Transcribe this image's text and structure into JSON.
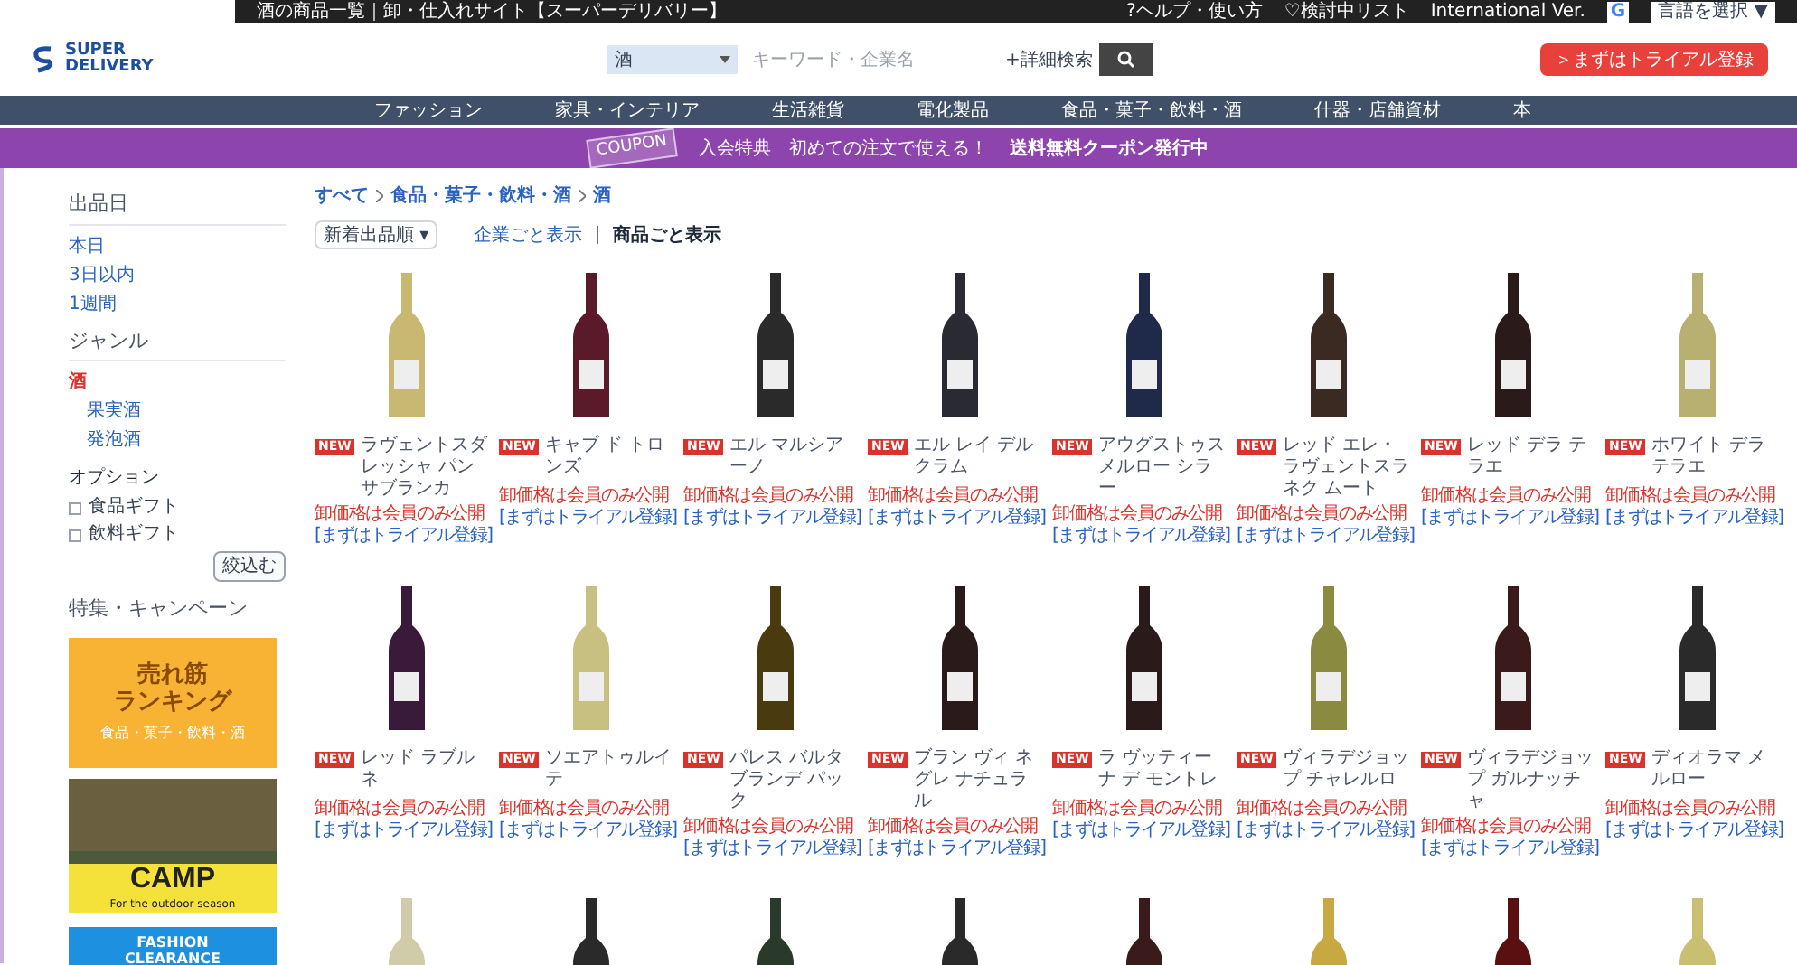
{
  "top_bar": {
    "page_title": "酒の商品一覧｜卸・仕入れサイト【スーパーデリバリー】",
    "links": [
      "?ヘルプ・使い方",
      "♡検討中リスト",
      "International Ver."
    ],
    "language_icon": "G",
    "language": "言語を選択 ▼"
  },
  "header": {
    "logo": [
      "SUPER",
      "DELIVERY"
    ],
    "search": {
      "category": "酒",
      "placeholder": "キーワード・企業名",
      "advanced": "+詳細検索"
    },
    "trial_button": "＞まずはトライアル登録"
  },
  "nav": [
    "ファッション",
    "家具・インテリア",
    "生活雑貨",
    "電化製品",
    "食品・菓子・飲料・酒",
    "什器・店舗資材",
    "本"
  ],
  "coupon_banner": {
    "badge": "COUPON",
    "text": "入会特典　初めての注文で使える！",
    "highlight": "送料無料クーポン発行中"
  },
  "sidebar": {
    "sections": [
      {
        "title": "出品日",
        "items": [
          {
            "label": "本日",
            "selected": false
          },
          {
            "label": "3日以内",
            "selected": false
          },
          {
            "label": "1週間",
            "selected": false
          }
        ]
      },
      {
        "title": "ジャンル",
        "items": [
          {
            "label": "酒",
            "selected": true,
            "children": [
              {
                "label": "果実酒",
                "selected": false
              },
              {
                "label": "発泡酒",
                "selected": false
              }
            ]
          }
        ]
      }
    ],
    "options": {
      "title": "オプション",
      "items": [
        {
          "label": "食品ギフト",
          "checked": false
        },
        {
          "label": "飲料ギフト",
          "checked": false
        }
      ]
    },
    "filter_button": "絞込む",
    "campaign_title": "特集・キャンペーン",
    "banners": [
      {
        "kind": "ranking",
        "lines": [
          "売れ筋",
          "ランキング"
        ],
        "sub": "食品・菓子・飲料・酒"
      },
      {
        "kind": "camp",
        "lines": [
          "CAMP"
        ],
        "sub": "For the outdoor season"
      },
      {
        "kind": "sale",
        "lines": [
          "FASHION",
          "CLEARANCE"
        ]
      }
    ]
  },
  "breadcrumb": [
    "すべて",
    "食品・菓子・飲料・酒",
    "酒"
  ],
  "sort": {
    "select": "新着出品順 ▾",
    "views": [
      {
        "label": "企業ごと表示",
        "selected": false
      },
      {
        "label": "商品ごと表示",
        "selected": true
      }
    ]
  },
  "products": [
    {
      "kind": "full",
      "badge": "NEW",
      "name": "ラヴェントスダレッシャ パンサブランカ",
      "price": "卸価格は会員のみ公開",
      "link": "[まずはトライアル登録]",
      "color": "#c9b872"
    },
    {
      "kind": "full",
      "badge": "NEW",
      "name": "キャブ ド トロンズ",
      "price": "卸価格は会員のみ公開",
      "link": "[まずはトライアル登録]",
      "color": "#5a1a2a"
    },
    {
      "kind": "full",
      "badge": "NEW",
      "name": "エル マルシアーノ",
      "price": "卸価格は会員のみ公開",
      "link": "[まずはトライアル登録]",
      "color": "#2a2a2a"
    },
    {
      "kind": "full",
      "badge": "NEW",
      "name": "エル レイ デルクラム",
      "price": "卸価格は会員のみ公開",
      "link": "[まずはトライアル登録]",
      "color": "#2a2a33"
    },
    {
      "kind": "full",
      "badge": "NEW",
      "name": "アウグストゥスメルロー シラー",
      "price": "卸価格は会員のみ公開",
      "link": "[まずはトライアル登録]",
      "color": "#1f2a4a"
    },
    {
      "kind": "full",
      "badge": "NEW",
      "name": "レッド エレ・ラヴェントスラネク ムート",
      "price": "卸価格は会員のみ公開",
      "link": "[まずはトライアル登録]",
      "color": "#3a2a22"
    },
    {
      "kind": "full",
      "badge": "NEW",
      "name": "レッド デラ テラエ",
      "price": "卸価格は会員のみ公開",
      "link": "[まずはトライアル登録]",
      "color": "#2a1a1a"
    },
    {
      "kind": "full",
      "badge": "NEW",
      "name": "ホワイト デラテラエ",
      "price": "卸価格は会員のみ公開",
      "link": "[まずはトライアル登録]",
      "color": "#b8b070"
    },
    {
      "kind": "full",
      "badge": "NEW",
      "name": "レッド ラブルネ",
      "price": "卸価格は会員のみ公開",
      "link": "[まずはトライアル登録]",
      "color": "#3a1a3a"
    },
    {
      "kind": "full",
      "badge": "NEW",
      "name": "ソエアトゥルイテ",
      "price": "卸価格は会員のみ公開",
      "link": "[まずはトライアル登録]",
      "color": "#c8c080"
    },
    {
      "kind": "full",
      "badge": "NEW",
      "name": "パレス バルタブランデ パック",
      "price": "卸価格は会員のみ公開",
      "link": "[まずはトライアル登録]",
      "color": "#4a3a10"
    },
    {
      "kind": "full",
      "badge": "NEW",
      "name": "ブラン ヴィ ネグレ ナチュラル",
      "price": "卸価格は会員のみ公開",
      "link": "[まずはトライアル登録]",
      "color": "#2a1a1a"
    },
    {
      "kind": "full",
      "badge": "NEW",
      "name": "ラ ヴッティーナ デ モントレ",
      "price": "卸価格は会員のみ公開",
      "link": "[まずはトライアル登録]",
      "color": "#2a1a1a"
    },
    {
      "kind": "full",
      "badge": "NEW",
      "name": "ヴィラデジョップ チャレルロ",
      "price": "卸価格は会員のみ公開",
      "link": "[まずはトライアル登録]",
      "color": "#8a8a40"
    },
    {
      "kind": "full",
      "badge": "NEW",
      "name": "ヴィラデジョップ ガルナッチャ",
      "price": "卸価格は会員のみ公開",
      "link": "[まずはトライアル登録]",
      "color": "#3a1a1a"
    },
    {
      "kind": "full",
      "badge": "NEW",
      "name": "ディオラマ メルロー",
      "price": "卸価格は会員のみ公開",
      "link": "[まずはトライアル登録]",
      "color": "#2a2a2a"
    },
    {
      "kind": "image_only",
      "color": "#d0ccaa"
    },
    {
      "kind": "image_only",
      "color": "#2a2a2a"
    },
    {
      "kind": "image_only",
      "color": "#2a3a2a"
    },
    {
      "kind": "image_only",
      "color": "#2a2a2a"
    },
    {
      "kind": "image_only",
      "color": "#3a1a1a"
    },
    {
      "kind": "image_only",
      "color": "#c8a840"
    },
    {
      "kind": "image_only",
      "color": "#5a1010"
    },
    {
      "kind": "image_only",
      "color": "#c8c070"
    }
  ]
}
